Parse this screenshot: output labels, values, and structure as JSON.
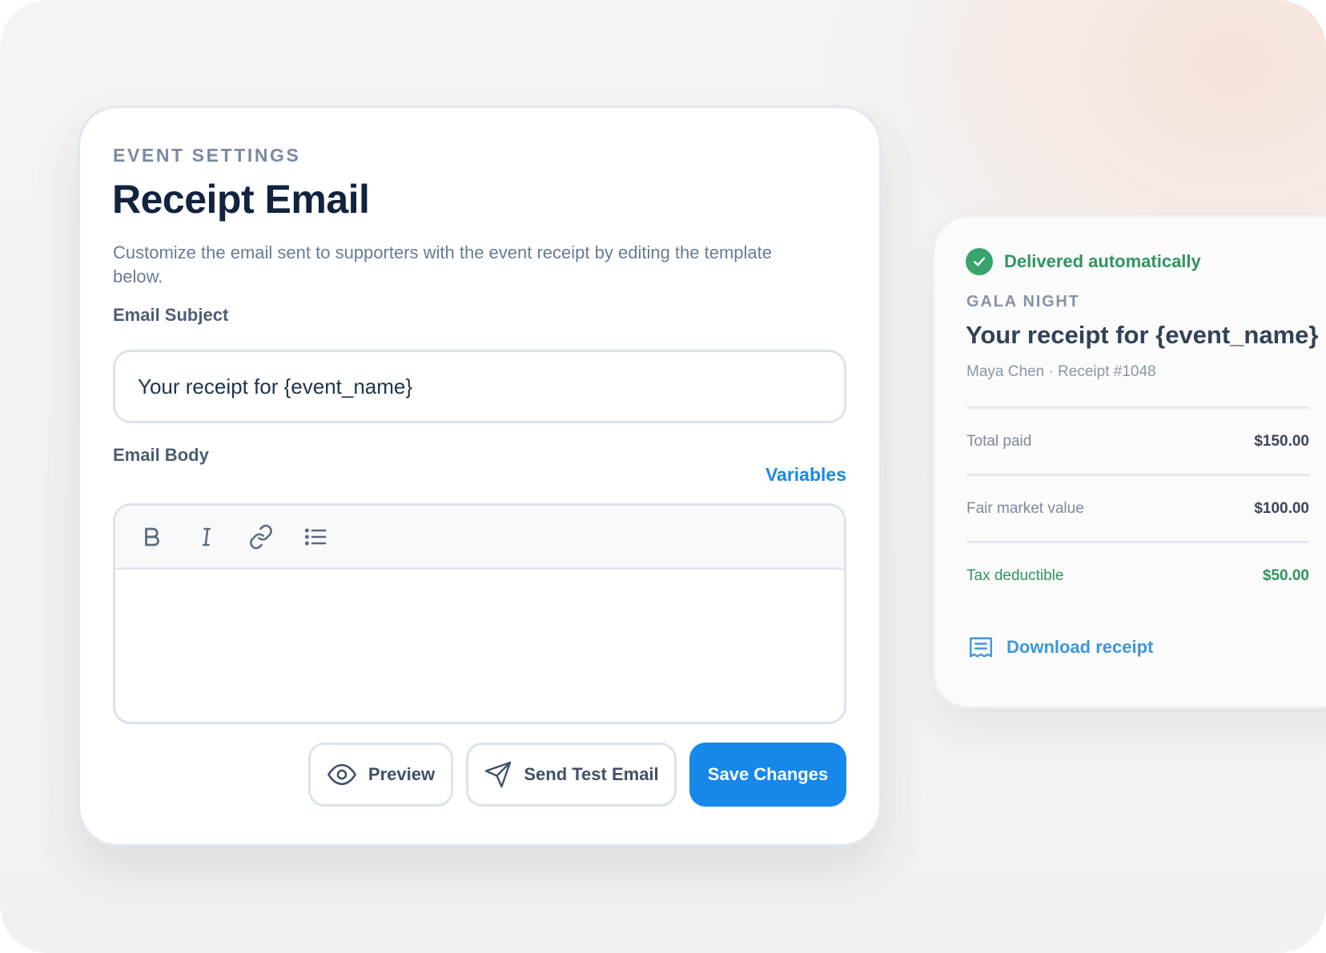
{
  "editor": {
    "eyebrow": "EVENT SETTINGS",
    "title": "Receipt Email",
    "description": "Customize the email sent to supporters with the event receipt by editing the template below.",
    "subject_label": "Email Subject",
    "subject_value": "Your receipt for {event_name}",
    "body_label": "Email Body",
    "variables_link": "Variables",
    "toolbar": [
      "bold-icon",
      "italic-icon",
      "link-icon",
      "list-icon"
    ],
    "body_value": "",
    "actions": {
      "preview": "Preview",
      "send_test": "Send Test Email",
      "save": "Save Changes"
    }
  },
  "receipt": {
    "status": "Delivered automatically",
    "event": "GALA NIGHT",
    "title": "Your receipt for {event_name}",
    "meta": "Maya Chen · Receipt #1048",
    "rows": [
      {
        "label": "Total paid",
        "value": "$150.00"
      },
      {
        "label": "Fair market value",
        "value": "$100.00"
      },
      {
        "label": "Tax deductible",
        "value": "$50.00"
      }
    ],
    "download": "Download receipt"
  },
  "colors": {
    "primary": "#1588ea",
    "success": "#37a56c",
    "title": "#10233f"
  }
}
